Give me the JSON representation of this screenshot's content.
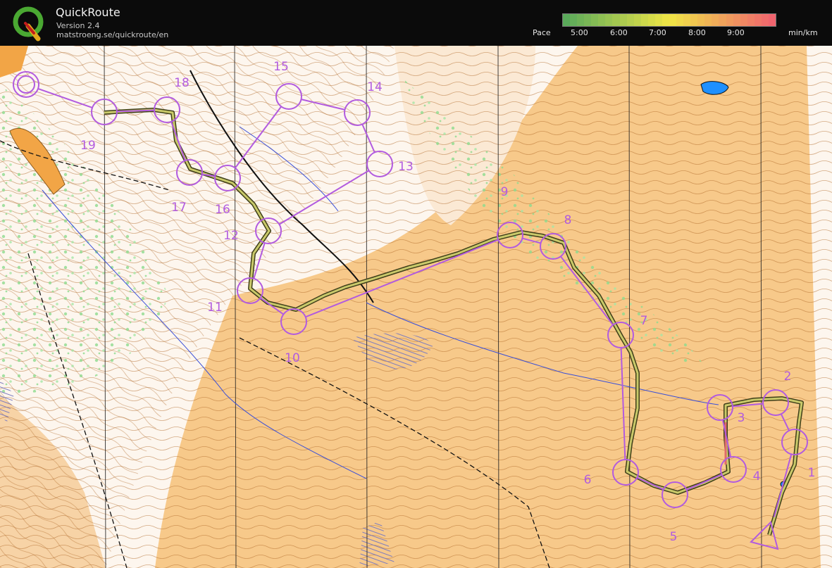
{
  "app": {
    "name": "QuickRoute",
    "version": "Version 2.4",
    "url": "matstroeng.se/quickroute/en",
    "logo_letter": "Q"
  },
  "legend": {
    "label": "Pace",
    "ticks": [
      "5:00",
      "6:00",
      "7:00",
      "8:00",
      "9:00"
    ],
    "unit": "min/km"
  },
  "colors": {
    "header_bg": "#0b0b0b",
    "course_purple": "#b25bdf",
    "route_olive": "#8a8a3a",
    "map_orange": "#f7c98a",
    "vegetation_green": "#9be59b",
    "water_blue": "#1e90ff"
  },
  "controls": [
    {
      "number": "1"
    },
    {
      "number": "2"
    },
    {
      "number": "3"
    },
    {
      "number": "4"
    },
    {
      "number": "5"
    },
    {
      "number": "6"
    },
    {
      "number": "7"
    },
    {
      "number": "8"
    },
    {
      "number": "9"
    },
    {
      "number": "10"
    },
    {
      "number": "11"
    },
    {
      "number": "12"
    },
    {
      "number": "13"
    },
    {
      "number": "14"
    },
    {
      "number": "15"
    },
    {
      "number": "16"
    },
    {
      "number": "17"
    },
    {
      "number": "18"
    },
    {
      "number": "19"
    }
  ]
}
